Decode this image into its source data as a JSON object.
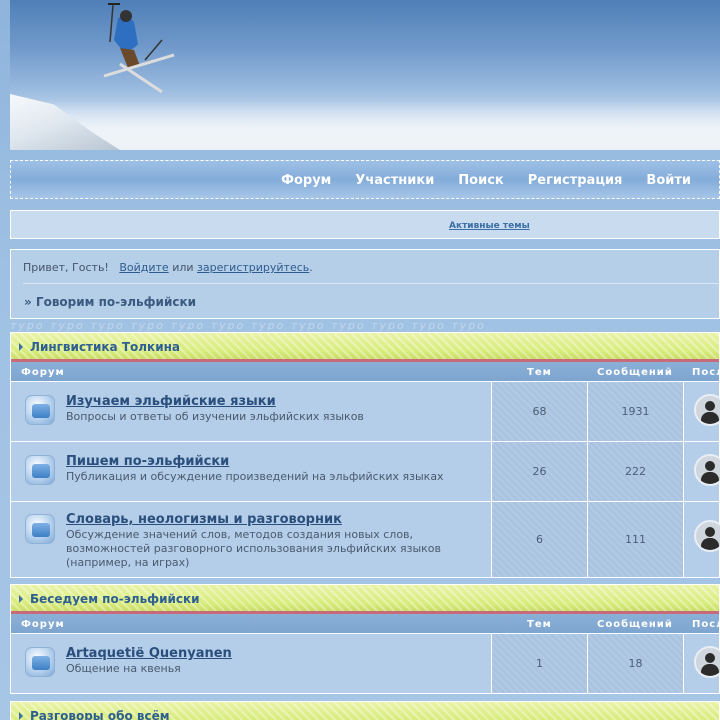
{
  "nav": {
    "items": [
      "Форум",
      "Участники",
      "Поиск",
      "Регистрация",
      "Войти"
    ]
  },
  "active_topics": "Активные темы",
  "welcome": {
    "greeting": "Привет, Гость!",
    "login": "Войдите",
    "or": "или",
    "register": "зарегистрируйтесь",
    "period": ".",
    "breadcrumb": "» Говорим по-эльфийски"
  },
  "watermark": "туро туро туро туро туро туро туро туро туро туро туро туро",
  "columns": {
    "forum": "Форум",
    "topics": "Тем",
    "posts": "Сообщений",
    "last": "Посл"
  },
  "categories": [
    {
      "title": "Лингвистика Толкина",
      "forums": [
        {
          "name": "Изучаем эльфийские языки",
          "desc": "Вопросы и ответы об изучении эльфийских языков",
          "topics": "68",
          "posts": "1931"
        },
        {
          "name": "Пишем по-эльфийски",
          "desc": "Публикация и обсуждение произведений на эльфийских языках",
          "topics": "26",
          "posts": "222"
        },
        {
          "name": "Словарь, неологизмы и разговорник",
          "desc": "Обсуждение значений слов, методов создания новых слов, возможностей разговорного использования эльфийских языков (например, на играх)",
          "topics": "6",
          "posts": "111"
        }
      ]
    },
    {
      "title": "Беседуем по-эльфийски",
      "forums": [
        {
          "name": "Artaquetië Quenyanen",
          "desc": "Общение на квенья",
          "topics": "1",
          "posts": "18"
        }
      ]
    },
    {
      "title": "Разговоры обо всём",
      "forums": []
    }
  ],
  "colors": {
    "nav_text": "#ffffff",
    "category_bar": "#d8ec7c",
    "category_underline": "#c86a7a",
    "link": "#2a4f7c"
  }
}
